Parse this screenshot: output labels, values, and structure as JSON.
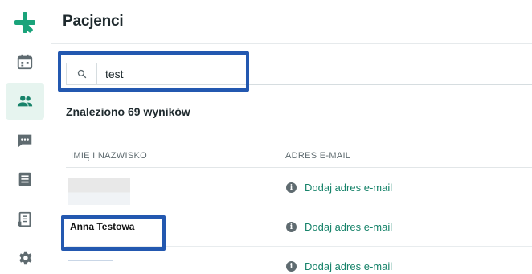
{
  "app": {
    "brand_color": "#1aa37a",
    "highlight_color": "#2358b0"
  },
  "sidebar": {
    "items": [
      {
        "name": "calendar",
        "icon": "calendar-icon",
        "active": false
      },
      {
        "name": "patients",
        "icon": "patients-icon",
        "active": true
      },
      {
        "name": "messages",
        "icon": "chat-icon",
        "active": false
      },
      {
        "name": "documents",
        "icon": "document-list-icon",
        "active": false
      },
      {
        "name": "receipts",
        "icon": "receipt-icon",
        "active": false
      },
      {
        "name": "settings",
        "icon": "gear-icon",
        "active": false
      }
    ]
  },
  "header": {
    "title": "Pacjenci"
  },
  "search": {
    "value": "test",
    "placeholder": ""
  },
  "results": {
    "count_text": "Znaleziono 69 wyników"
  },
  "table": {
    "columns": [
      "IMIĘ I NAZWISKO",
      "ADRES E-MAIL"
    ],
    "rows": [
      {
        "name": "",
        "email_action": "Dodaj adres e-mail",
        "name_redacted": true
      },
      {
        "name": "Anna Testowa",
        "email_action": "Dodaj adres e-mail",
        "name_redacted": false
      },
      {
        "name": "",
        "email_action": "Dodaj adres e-mail",
        "name_redacted": true
      }
    ]
  },
  "icons": {
    "info_glyph": "i"
  }
}
